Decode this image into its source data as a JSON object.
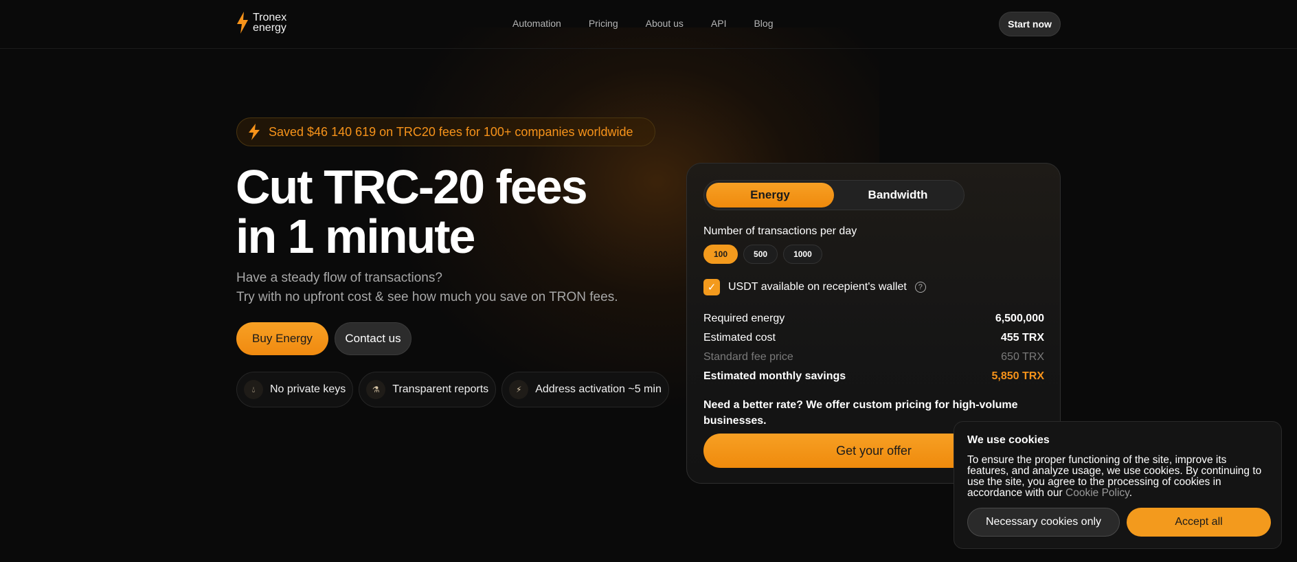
{
  "brand": {
    "name_line1": "Tronex",
    "name_line2": "energy",
    "logo_icon": "lightning-bolt-icon",
    "accent_color": "#f7931a"
  },
  "nav": {
    "items": [
      "Automation",
      "Pricing",
      "About us",
      "API",
      "Blog"
    ],
    "cta": "Start now"
  },
  "hero": {
    "badge": "Saved $46 140 619 on TRC20 fees for 100+ companies worldwide",
    "title_line1": "Cut TRC-20 fees",
    "title_line2": "in 1 minute",
    "sub_line1": "Have a steady flow of transactions?",
    "sub_line2": "Try with no upfront cost & see how much you save on TRON fees.",
    "buy_label": "Buy Energy",
    "contact_label": "Contact us",
    "features": [
      {
        "icon": "droplet-icon",
        "label": "No private keys"
      },
      {
        "icon": "flask-icon",
        "label": "Transparent reports"
      },
      {
        "icon": "lightning-bolt-icon",
        "label": "Address activation ~5 min"
      }
    ]
  },
  "calculator": {
    "tabs": [
      "Energy",
      "Bandwidth"
    ],
    "active_tab": "Energy",
    "tx_label": "Number of transactions per day",
    "tx_options": [
      "100",
      "500",
      "1000"
    ],
    "tx_selected": "100",
    "usdt_checkbox_label": "USDT available on recepient's wallet",
    "usdt_checked": true,
    "rows": [
      {
        "label": "Required energy",
        "value": "6,500,000"
      },
      {
        "label": "Estimated cost",
        "value": "455 TRX"
      },
      {
        "label": "Standard fee price",
        "value": "650 TRX"
      },
      {
        "label": "Estimated monthly savings",
        "value": "5,850 TRX"
      }
    ],
    "rate_note": "Need a better rate? We offer custom pricing for high-volume businesses.",
    "offer_label": "Get your offer"
  },
  "cookies": {
    "title": "We use cookies",
    "text": "To ensure the proper functioning of the site, improve its features, and analyze usage, we use cookies. By continuing to use the site, you agree to the processing of cookies in accordance with our",
    "link": "Cookie Policy",
    "period": ".",
    "necessary_label": "Necessary cookies only",
    "accept_label": "Accept all"
  }
}
